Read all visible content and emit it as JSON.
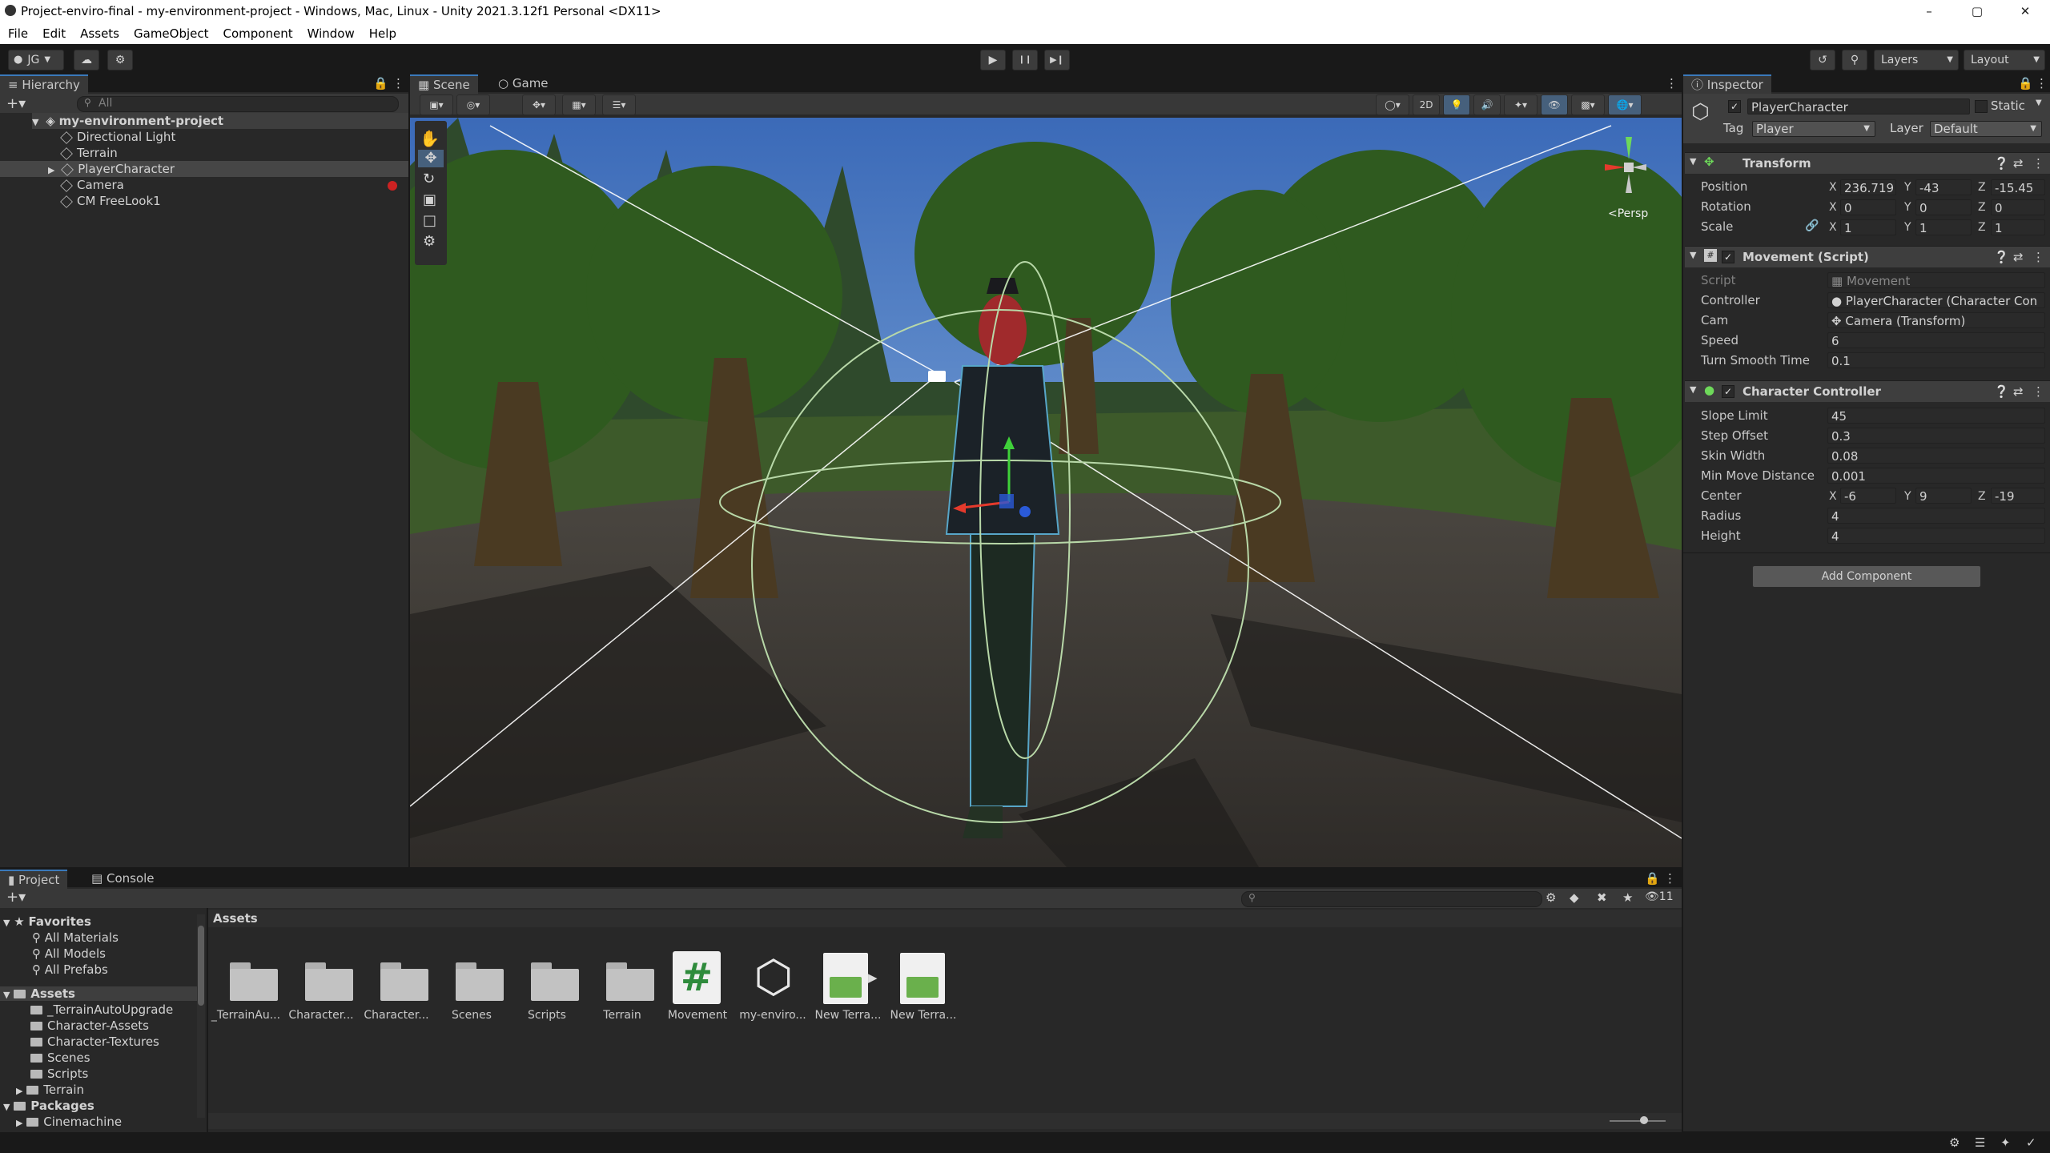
{
  "window": {
    "title": "Project-enviro-final - my-environment-project - Windows, Mac, Linux - Unity 2021.3.12f1 Personal <DX11>",
    "controls": [
      "–",
      "▢",
      "✕"
    ]
  },
  "menu": [
    "File",
    "Edit",
    "Assets",
    "GameObject",
    "Component",
    "Window",
    "Help"
  ],
  "toolbar": {
    "account": "JG",
    "play_icons": [
      "▶",
      "❙❙",
      "▶❙"
    ],
    "layers": "Layers",
    "layout": "Layout"
  },
  "hierarchy": {
    "tab": "Hierarchy",
    "search_placeholder": "All",
    "scene": "my-environment-project",
    "items": [
      "Directional Light",
      "Terrain",
      "PlayerCharacter",
      "Camera",
      "CM FreeLook1"
    ]
  },
  "scene_view": {
    "tabs": [
      "Scene",
      "Game"
    ],
    "mode_2d": "2D",
    "persp": "<Persp"
  },
  "inspector": {
    "tab": "Inspector",
    "object_name": "PlayerCharacter",
    "static_label": "Static",
    "tag_label": "Tag",
    "tag_value": "Player",
    "layer_label": "Layer",
    "layer_value": "Default",
    "transform": {
      "title": "Transform",
      "rows": [
        {
          "label": "Position",
          "x": "236.719",
          "y": "-43",
          "z": "-15.45"
        },
        {
          "label": "Rotation",
          "x": "0",
          "y": "0",
          "z": "0"
        },
        {
          "label": "Scale",
          "x": "1",
          "y": "1",
          "z": "1"
        }
      ]
    },
    "movement": {
      "title": "Movement (Script)",
      "rows": [
        {
          "label": "Script",
          "value": "Movement"
        },
        {
          "label": "Controller",
          "value": "PlayerCharacter (Character Con"
        },
        {
          "label": "Cam",
          "value": "Camera (Transform)"
        },
        {
          "label": "Speed",
          "value": "6"
        },
        {
          "label": "Turn Smooth Time",
          "value": "0.1"
        }
      ]
    },
    "character_controller": {
      "title": "Character Controller",
      "rows": [
        {
          "label": "Slope Limit",
          "value": "45"
        },
        {
          "label": "Step Offset",
          "value": "0.3"
        },
        {
          "label": "Skin Width",
          "value": "0.08"
        },
        {
          "label": "Min Move Distance",
          "value": "0.001"
        },
        {
          "label": "Radius",
          "value": "4"
        },
        {
          "label": "Height",
          "value": "4"
        }
      ],
      "center": {
        "label": "Center",
        "x": "-6",
        "y": "9",
        "z": "-19"
      }
    },
    "add_component": "Add Component",
    "axes": [
      "X",
      "Y",
      "Z"
    ]
  },
  "project": {
    "tabs": [
      "Project",
      "Console"
    ],
    "favorites_title": "Favorites",
    "favorites": [
      "All Materials",
      "All Models",
      "All Prefabs"
    ],
    "assets_title": "Assets",
    "asset_folders": [
      "_TerrainAutoUpgrade",
      "Character-Assets",
      "Character-Textures",
      "Scenes",
      "Scripts",
      "Terrain"
    ],
    "packages_title": "Packages",
    "packages": [
      "Cinemachine"
    ],
    "breadcrumb": "Assets",
    "hidden_count": "11",
    "grid": [
      {
        "label": "_TerrainAu...",
        "kind": "folder"
      },
      {
        "label": "Character...",
        "kind": "folder"
      },
      {
        "label": "Character...",
        "kind": "folder"
      },
      {
        "label": "Scenes",
        "kind": "folder"
      },
      {
        "label": "Scripts",
        "kind": "folder"
      },
      {
        "label": "Terrain",
        "kind": "folder"
      },
      {
        "label": "Movement",
        "kind": "script"
      },
      {
        "label": "my-enviro...",
        "kind": "unity-scene"
      },
      {
        "label": "New Terra...",
        "kind": "terrain-data"
      },
      {
        "label": "New Terra...",
        "kind": "terrain-layer"
      }
    ]
  },
  "colors": {
    "accent": "#3a79bb",
    "panel": "#282828",
    "header": "#3e3e3e"
  }
}
